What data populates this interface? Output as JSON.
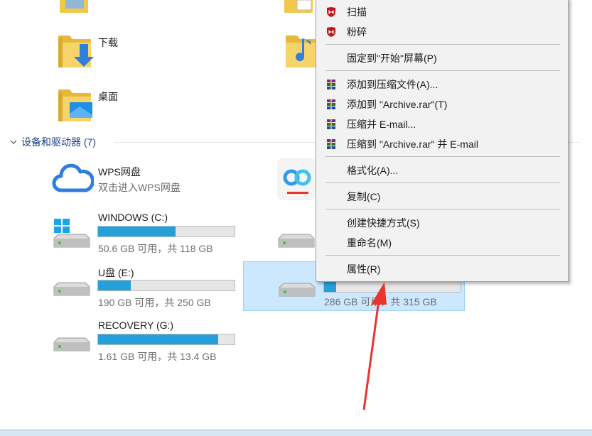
{
  "folders": [
    {
      "label": "下载",
      "icon": "downloads-folder-icon"
    },
    {
      "label": "桌面",
      "icon": "desktop-folder-icon"
    }
  ],
  "section": {
    "title": "设备和驱动器 (7)"
  },
  "wps": {
    "name": "WPS网盘",
    "subtitle": "双击进入WPS网盘"
  },
  "drives": [
    {
      "name": "WINDOWS (C:)",
      "info": "50.6 GB 可用，共 118 GB",
      "used_fraction": 0.57
    },
    {
      "name": "U盘 (E:)",
      "info": "190 GB 可用，共 250 GB",
      "used_fraction": 0.24
    },
    {
      "name": "RECOVERY (G:)",
      "info": "1.61 GB 可用，共 13.4 GB",
      "used_fraction": 0.88
    }
  ],
  "selected_drive": {
    "info": "286 GB 可用，共 315 GB",
    "used_fraction": 0.09
  },
  "context_menu": {
    "scan": "扫描",
    "shred": "粉碎",
    "pin_start": "固定到\"开始\"屏幕(P)",
    "add_archive": "添加到压缩文件(A)...",
    "add_rar": "添加到 \"Archive.rar\"(T)",
    "compress_email": "压缩并 E-mail...",
    "compress_rar_email": "压缩到 \"Archive.rar\" 并 E-mail",
    "format": "格式化(A)...",
    "copy": "复制(C)",
    "shortcut": "创建快捷方式(S)",
    "rename": "重命名(M)",
    "properties": "属性(R)"
  },
  "colors": {
    "accent": "#26a0da",
    "selection": "#cce8ff",
    "annotation": "#e8352e",
    "mcafee": "#c01818"
  }
}
